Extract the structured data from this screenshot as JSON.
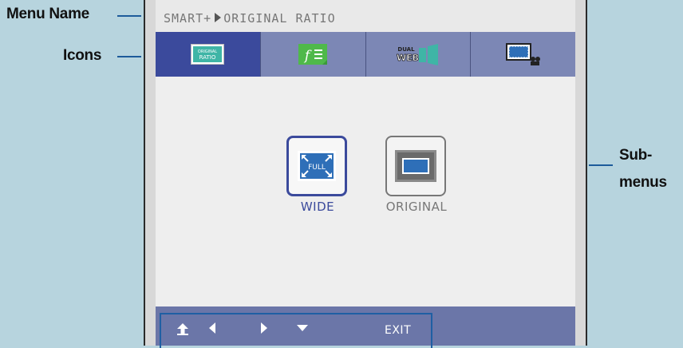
{
  "callouts": {
    "menu_name": "Menu Name",
    "icons": "Icons",
    "submenus_line1": "Sub-",
    "submenus_line2": "menus"
  },
  "osd": {
    "title_prefix": "SMART+",
    "title_suffix": "ORIGINAL RATIO",
    "tabs": [
      {
        "icon": "original-ratio-icon",
        "text_top": "ORIGINAL",
        "text_bottom": "RATIO",
        "active": true
      },
      {
        "icon": "f-engine-icon",
        "text": "f"
      },
      {
        "icon": "dual-web-icon",
        "text_top": "DUAL",
        "text_bottom": "WEB"
      },
      {
        "icon": "cinema-mode-icon"
      }
    ],
    "options": [
      {
        "label": "WIDE",
        "icon_text": "FULL",
        "selected": true
      },
      {
        "label": "ORIGINAL",
        "selected": false
      }
    ],
    "bottom": {
      "buttons": [
        "up-arrow-icon",
        "left-arrow-icon",
        "right-arrow-icon",
        "down-arrow-icon"
      ],
      "exit_label": "EXIT"
    }
  },
  "colors": {
    "accent": "#3b4a9c",
    "tab_bar": "#7c87b5",
    "bottom_bar": "#6b76a8",
    "callout_line": "#1d5b9a",
    "background": "#b7d4de"
  }
}
